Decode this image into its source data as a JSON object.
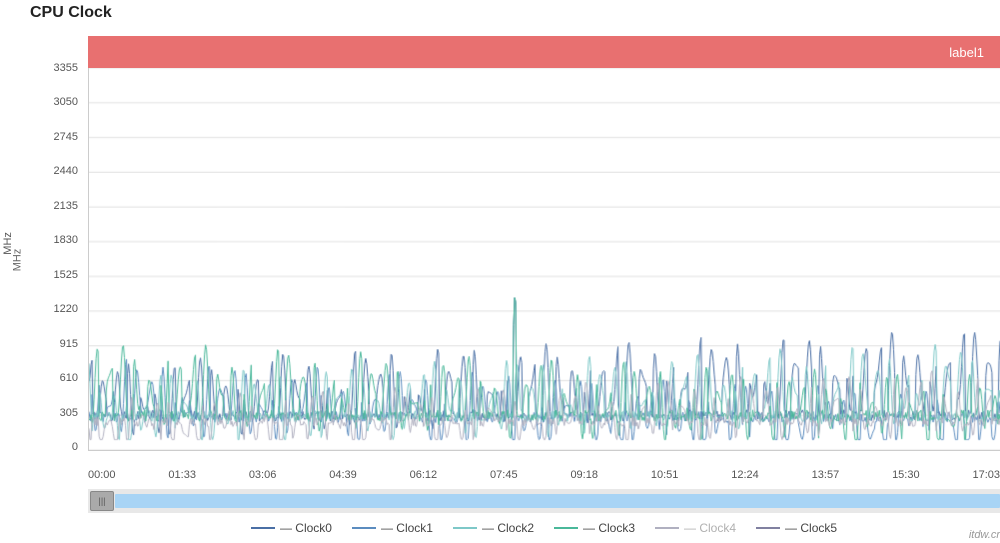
{
  "title": "CPU Clock",
  "legend_bar": {
    "label": "label1",
    "color": "#e87070"
  },
  "y_axis": {
    "unit": "MHz",
    "labels": [
      "3355",
      "3050",
      "2745",
      "2440",
      "2135",
      "1830",
      "1525",
      "1220",
      "915",
      "610",
      "305",
      "0"
    ]
  },
  "x_axis": {
    "labels": [
      "00:00",
      "01:33",
      "03:06",
      "04:39",
      "06:12",
      "07:45",
      "09:18",
      "10:51",
      "12:24",
      "13:57",
      "15:30",
      "17:03"
    ]
  },
  "legend": {
    "items": [
      {
        "name": "Clock0",
        "color": "#4a6fa5"
      },
      {
        "name": "Clock1",
        "color": "#5b8cbf"
      },
      {
        "name": "Clock2",
        "color": "#7ec8c8"
      },
      {
        "name": "Clock3",
        "color": "#4ab89a"
      },
      {
        "name": "Clock4",
        "color": "#b0b0c0"
      },
      {
        "name": "Clock5",
        "color": "#8080a0"
      }
    ]
  },
  "scrollbar": {
    "thumb_label": "|||"
  },
  "watermark": "itdw.cr"
}
